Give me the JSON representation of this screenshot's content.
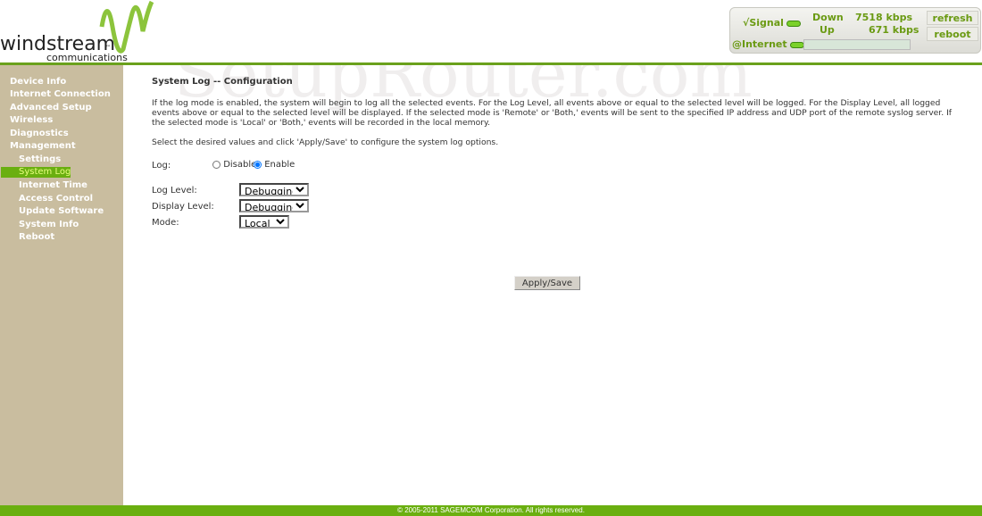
{
  "brand": {
    "name": "windstream",
    "tm": "™",
    "sub": "communications",
    "watermark": "SetupRouter.com"
  },
  "status": {
    "signal": "√Signal",
    "internet": "@Internet",
    "down_label": "Down",
    "up_label": "Up",
    "down_value": "7518 kbps",
    "up_value": "671 kbps",
    "refresh": "refresh",
    "reboot": "reboot"
  },
  "sidebar": {
    "items": [
      {
        "label": "Device Info"
      },
      {
        "label": "Internet Connection"
      },
      {
        "label": "Advanced Setup"
      },
      {
        "label": "Wireless"
      },
      {
        "label": "Diagnostics"
      },
      {
        "label": "Management"
      },
      {
        "label": "Settings"
      },
      {
        "label": "System Log"
      },
      {
        "label": "Internet Time"
      },
      {
        "label": "Access Control"
      },
      {
        "label": "Update Software"
      },
      {
        "label": "System Info"
      },
      {
        "label": "Reboot"
      }
    ]
  },
  "main": {
    "title": "System Log -- Configuration",
    "desc1": "If the log mode is enabled, the system will begin to log all the selected events. For the Log Level, all events above or equal to the selected level will be logged. For the Display Level, all logged",
    "desc2": "events above or equal to the selected level will be displayed. If the selected mode is 'Remote' or 'Both,' events will be sent to the specified IP address and UDP port of the remote syslog server. If",
    "desc3": "the selected mode is 'Local' or 'Both,' events will be recorded in the local memory.",
    "instr": "Select the desired values and click 'Apply/Save' to configure the system log options.",
    "log_label": "Log:",
    "disable": "Disable",
    "enable": "Enable",
    "log_enabled": true,
    "log_level_label": "Log Level:",
    "log_level": "Debugging",
    "display_level_label": "Display Level:",
    "display_level": "Debugging",
    "mode_label": "Mode:",
    "mode": "Local",
    "apply": "Apply/Save"
  },
  "footer": "© 2005-2011 SAGEMCOM Corporation. All rights reserved."
}
